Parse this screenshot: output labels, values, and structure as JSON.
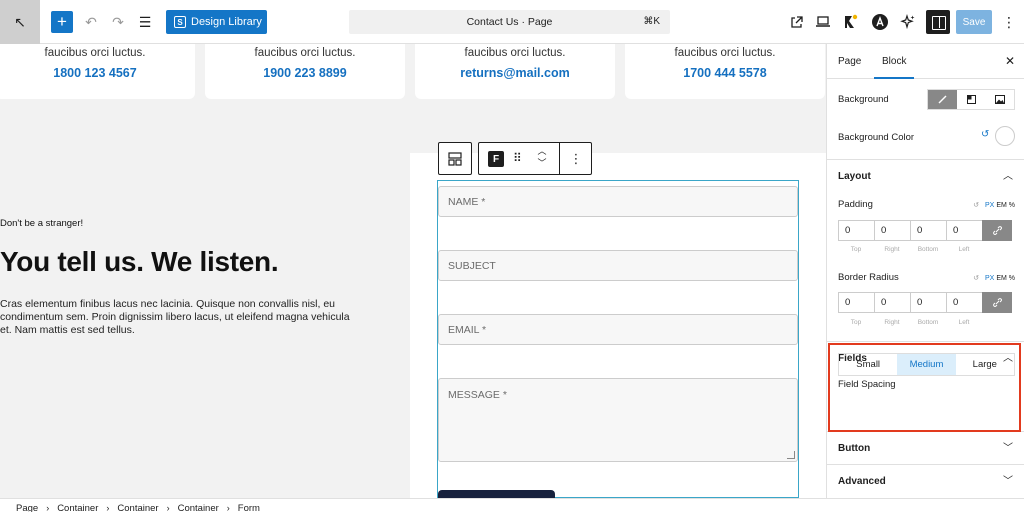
{
  "topbar": {
    "back_icon": "↖",
    "add_icon": "+",
    "undo_icon": "↶",
    "redo_icon": "↷",
    "list_view_icon": "☰",
    "design_library_label": "Design Library",
    "design_library_glyph": "S",
    "document_title": "Contact Us · Page",
    "shortcut": "⌘K",
    "save_label": "Save",
    "more_icon": "⋮"
  },
  "cards": [
    {
      "line1": "faucibus orci luctus.",
      "line2": "1800 123 4567"
    },
    {
      "line1": "faucibus orci luctus.",
      "line2": "1900 223 8899"
    },
    {
      "line1": "faucibus orci luctus.",
      "line2": "returns@mail.com"
    },
    {
      "line1": "faucibus orci luctus.",
      "line2": "1700 444 5578"
    }
  ],
  "content": {
    "tagline": "Don't be a stranger!",
    "headline": "You tell us. We listen.",
    "paragraph": "Cras elementum finibus lacus nec lacinia. Quisque non convallis nisl, eu condimentum sem. Proin dignissim libero lacus, ut eleifend magna vehicula et. Nam mattis est sed tellus."
  },
  "form": {
    "name_placeholder": "NAME *",
    "subject_placeholder": "SUBJECT",
    "email_placeholder": "EMAIL *",
    "message_placeholder": "MESSAGE *"
  },
  "block_toolbar": {
    "form_glyph": "F",
    "drag_glyph": "⠿",
    "up_glyph": "︿",
    "down_glyph": "﹀",
    "more_glyph": "⋮"
  },
  "breadcrumb": [
    "Page",
    "Container",
    "Container",
    "Container",
    "Form"
  ],
  "breadcrumb_separator": "›",
  "sidebar": {
    "tab_page": "Page",
    "tab_block": "Block",
    "close_icon": "✕",
    "background_label": "Background",
    "background_color_label": "Background Color",
    "reset_glyph": "↺",
    "layout_title": "Layout",
    "padding_label": "Padding",
    "border_radius_label": "Border Radius",
    "unit_px": "PX",
    "unit_em": "EM",
    "unit_pct": "%",
    "padding_values": {
      "top": "0",
      "right": "0",
      "bottom": "0",
      "left": "0"
    },
    "radius_values": {
      "top": "0",
      "right": "0",
      "bottom": "0",
      "left": "0"
    },
    "side_labels": {
      "top": "Top",
      "right": "Right",
      "bottom": "Bottom",
      "left": "Left"
    },
    "fields_title": "Fields",
    "field_spacing_label": "Field Spacing",
    "spacing_options": {
      "small": "Small",
      "medium": "Medium",
      "large": "Large"
    },
    "button_title": "Button",
    "advanced_title": "Advanced",
    "chevron_up": "︿",
    "chevron_down": "﹀"
  },
  "colors": {
    "accent": "#1476c7",
    "highlight": "#e23a1e",
    "link_text": "#1570c0"
  }
}
